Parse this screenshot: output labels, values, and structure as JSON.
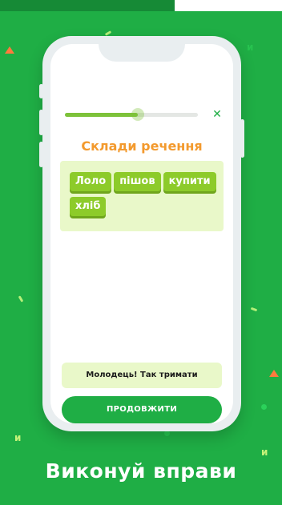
{
  "screen": {
    "title": "Склади речення",
    "progress": 0.55,
    "close_icon": "close-icon",
    "sentence_words": [
      "Лоло",
      "пішов",
      "купити",
      "хліб"
    ],
    "feedback_text": "Молодець! Так тримати",
    "continue_label": "ПРОДОВЖИТИ"
  },
  "promo": {
    "caption": "Виконуй вправи"
  },
  "colors": {
    "background": "#1fae45",
    "accent_orange": "#f39a2e",
    "chip_green": "#8dcb2a",
    "progress_green": "#7dc23a",
    "feedback_bg": "#e9f8c9"
  }
}
